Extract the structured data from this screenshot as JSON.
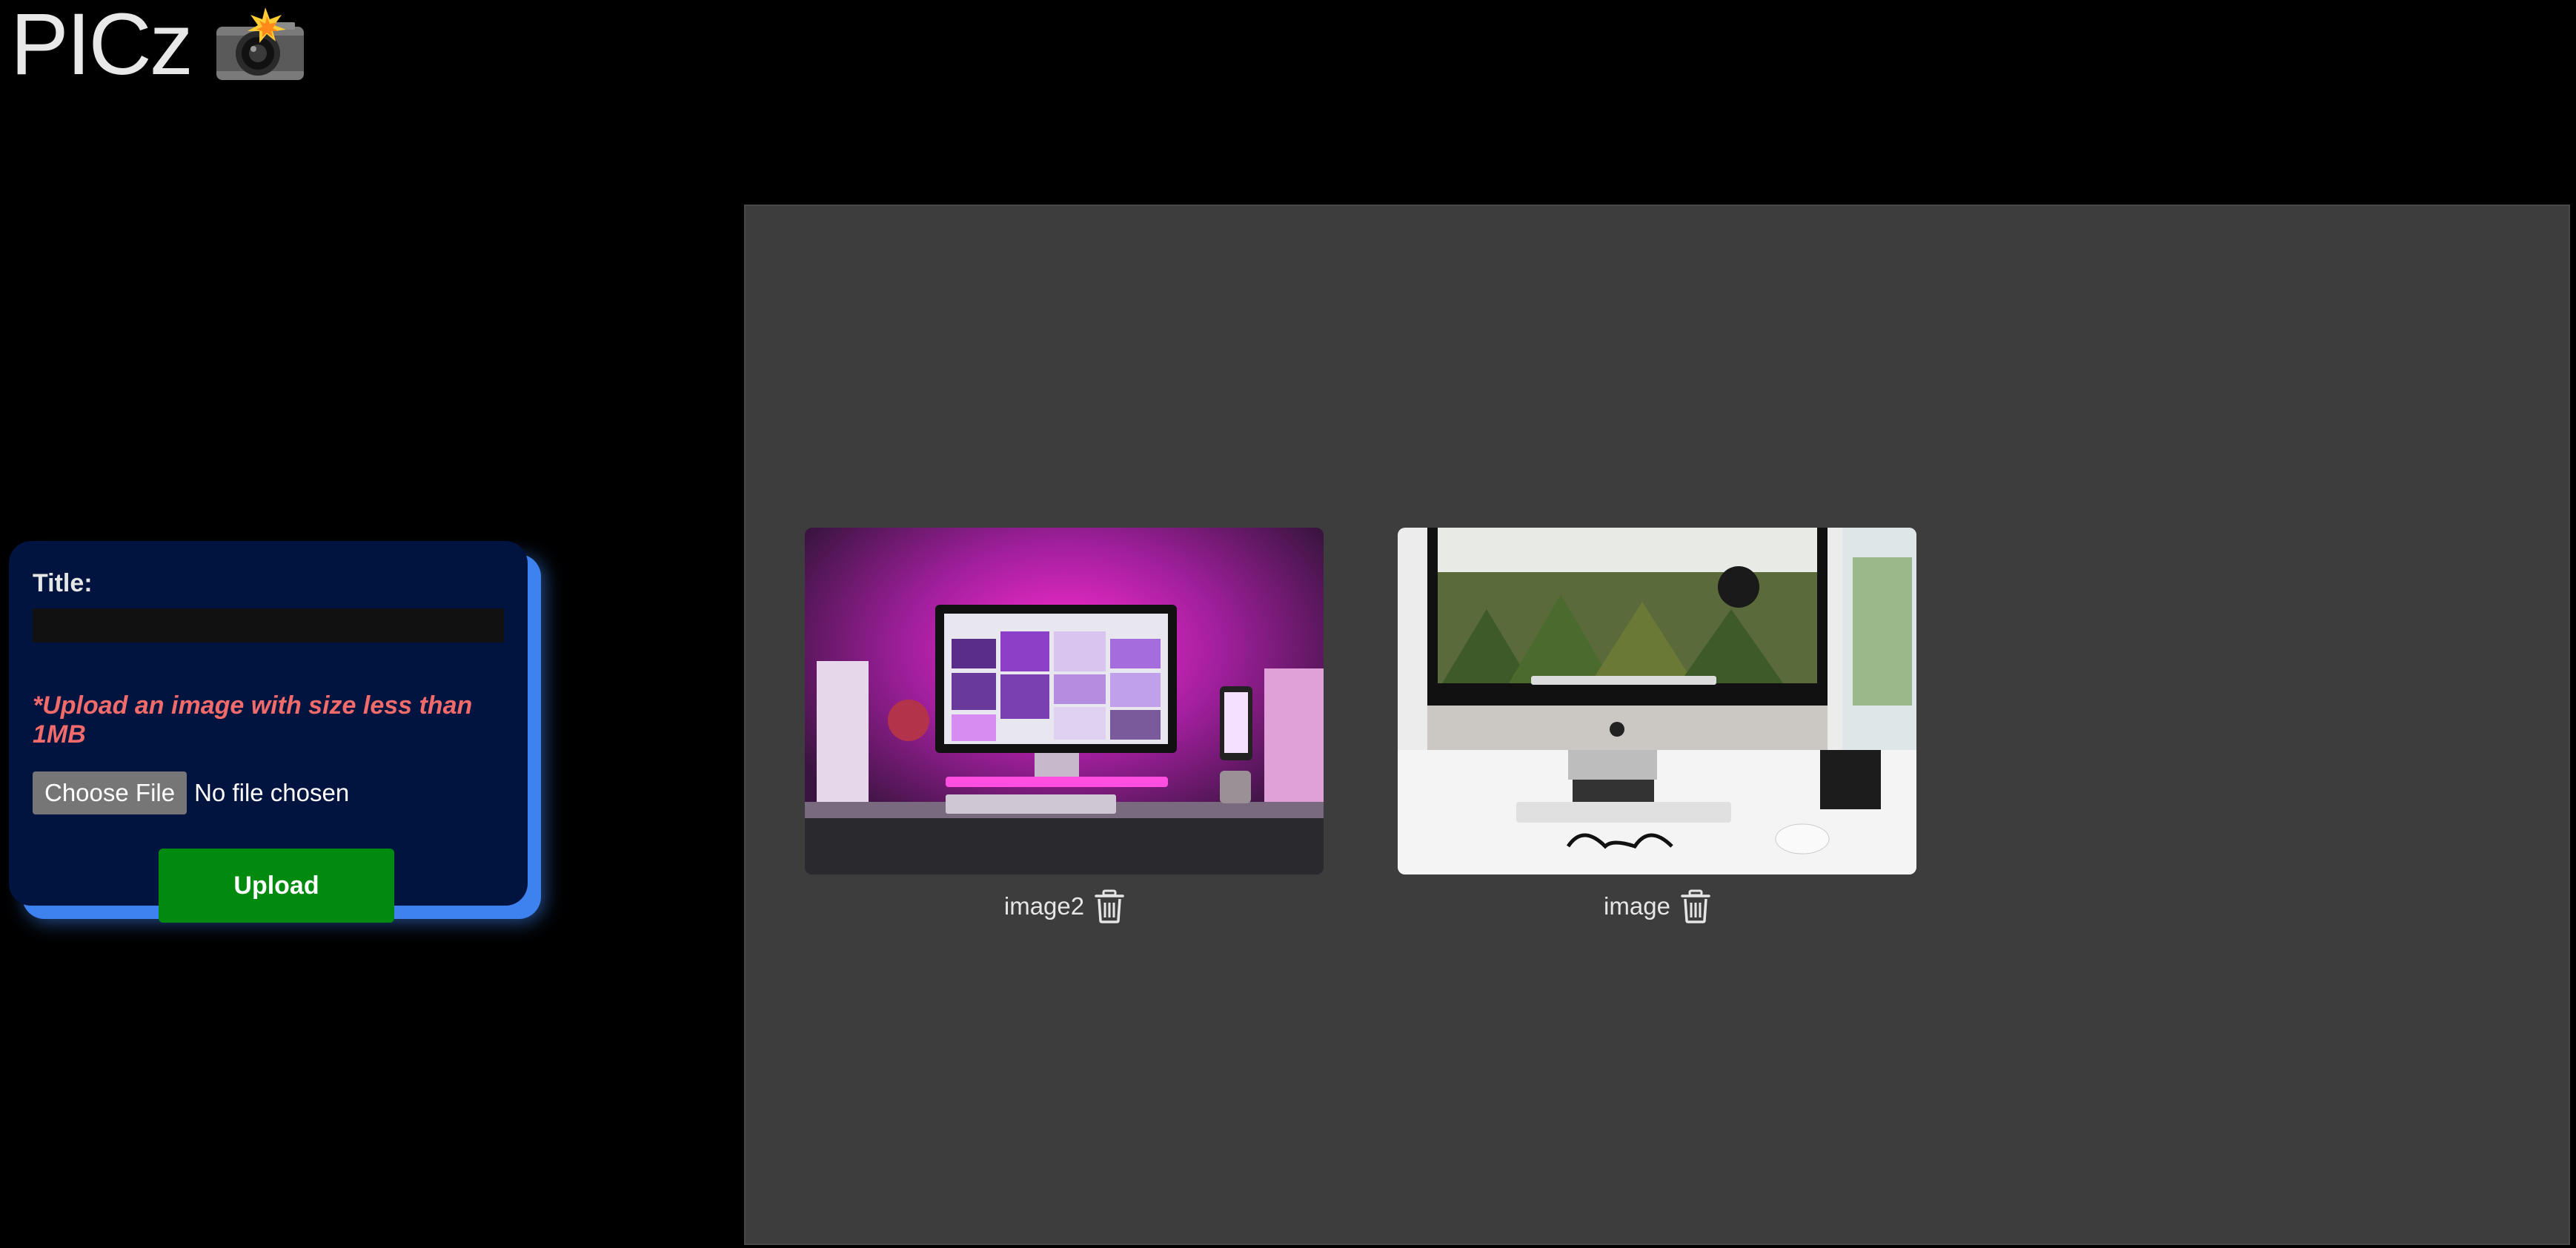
{
  "header": {
    "title": "PICz",
    "logo_icon": "camera-flash-icon"
  },
  "upload_form": {
    "title_label": "Title:",
    "title_value": "",
    "size_note": "*Upload an image with size less than 1MB",
    "choose_file_label": "Choose File",
    "file_status": "No file chosen",
    "upload_label": "Upload"
  },
  "gallery": {
    "items": [
      {
        "caption": "image2",
        "delete_icon": "trash-icon"
      },
      {
        "caption": "image",
        "delete_icon": "trash-icon"
      }
    ]
  },
  "colors": {
    "page_bg": "#000000",
    "card_bg": "#01133f",
    "card_shadow": "#3d82ee",
    "upload_button": "#008a10",
    "warning_text": "#f26b6b",
    "gallery_bg": "#3e3d3e"
  }
}
